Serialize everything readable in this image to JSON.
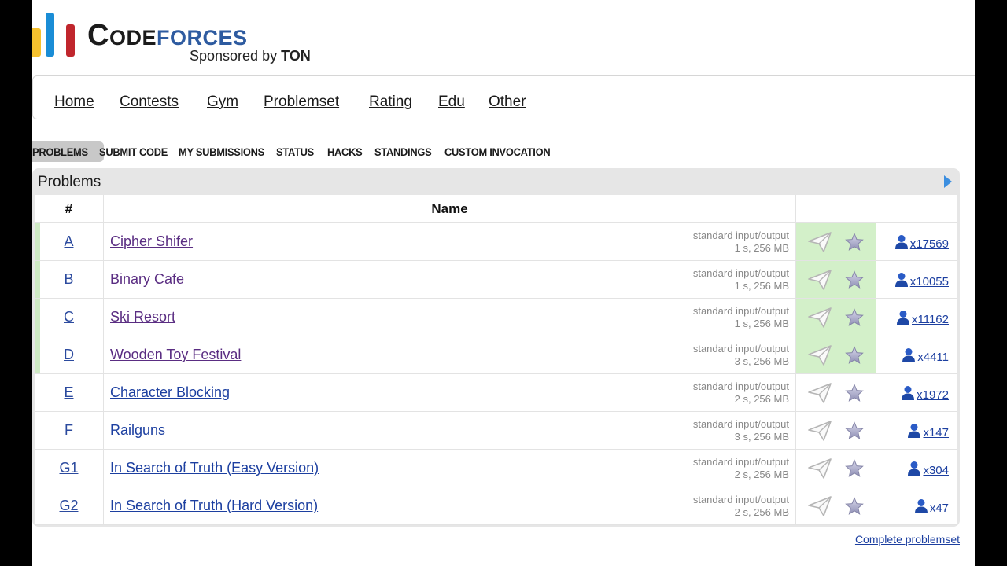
{
  "brand": {
    "word_part1": "Code",
    "word_part2": "forces",
    "sponsor_prefix": "Sponsored by ",
    "sponsor_name": "TON",
    "colors": {
      "bar_yellow": "#f6c12e",
      "bar_blue": "#1a8dd6",
      "bar_red": "#c0262d",
      "word_dark": "#1b1b1b",
      "word_blue": "#2e5ba0"
    }
  },
  "main_nav": [
    "Home",
    "Contests",
    "Gym",
    "Problemset",
    "Rating",
    "Edu",
    "Other"
  ],
  "sub_nav": {
    "items": [
      "PROBLEMS",
      "SUBMIT CODE",
      "MY SUBMISSIONS",
      "STATUS",
      "HACKS",
      "STANDINGS",
      "CUSTOM INVOCATION"
    ],
    "active": "PROBLEMS"
  },
  "problems": {
    "title": "Problems",
    "headers": {
      "index": "#",
      "name": "Name"
    },
    "rows": [
      {
        "index": "A",
        "name": "Cipher Shifer",
        "io": "standard input/output",
        "limits": "1 s, 256 MB",
        "solved": "x17569",
        "accepted": true
      },
      {
        "index": "B",
        "name": "Binary Cafe",
        "io": "standard input/output",
        "limits": "1 s, 256 MB",
        "solved": "x10055",
        "accepted": true
      },
      {
        "index": "C",
        "name": "Ski Resort",
        "io": "standard input/output",
        "limits": "1 s, 256 MB",
        "solved": "x11162",
        "accepted": true
      },
      {
        "index": "D",
        "name": "Wooden Toy Festival",
        "io": "standard input/output",
        "limits": "3 s, 256 MB",
        "solved": "x4411",
        "accepted": true
      },
      {
        "index": "E",
        "name": "Character Blocking",
        "io": "standard input/output",
        "limits": "2 s, 256 MB",
        "solved": "x1972",
        "accepted": false
      },
      {
        "index": "F",
        "name": "Railguns",
        "io": "standard input/output",
        "limits": "3 s, 256 MB",
        "solved": "x147",
        "accepted": false
      },
      {
        "index": "G1",
        "name": "In Search of Truth (Easy Version)",
        "io": "standard input/output",
        "limits": "2 s, 256 MB",
        "solved": "x304",
        "accepted": false
      },
      {
        "index": "G2",
        "name": "In Search of Truth (Hard Version)",
        "io": "standard input/output",
        "limits": "2 s, 256 MB",
        "solved": "x47",
        "accepted": false
      }
    ]
  },
  "footer": {
    "complete_problemset": "Complete problemset"
  },
  "icons": {
    "submit": "paper-plane-icon",
    "favorite": "star-icon",
    "solved": "user-icon",
    "expand": "triangle-right-icon"
  },
  "colors": {
    "accepted_bg": "#d3f0c9",
    "link_blue": "#1c3fa0",
    "visited_purple": "#5a2d82"
  }
}
